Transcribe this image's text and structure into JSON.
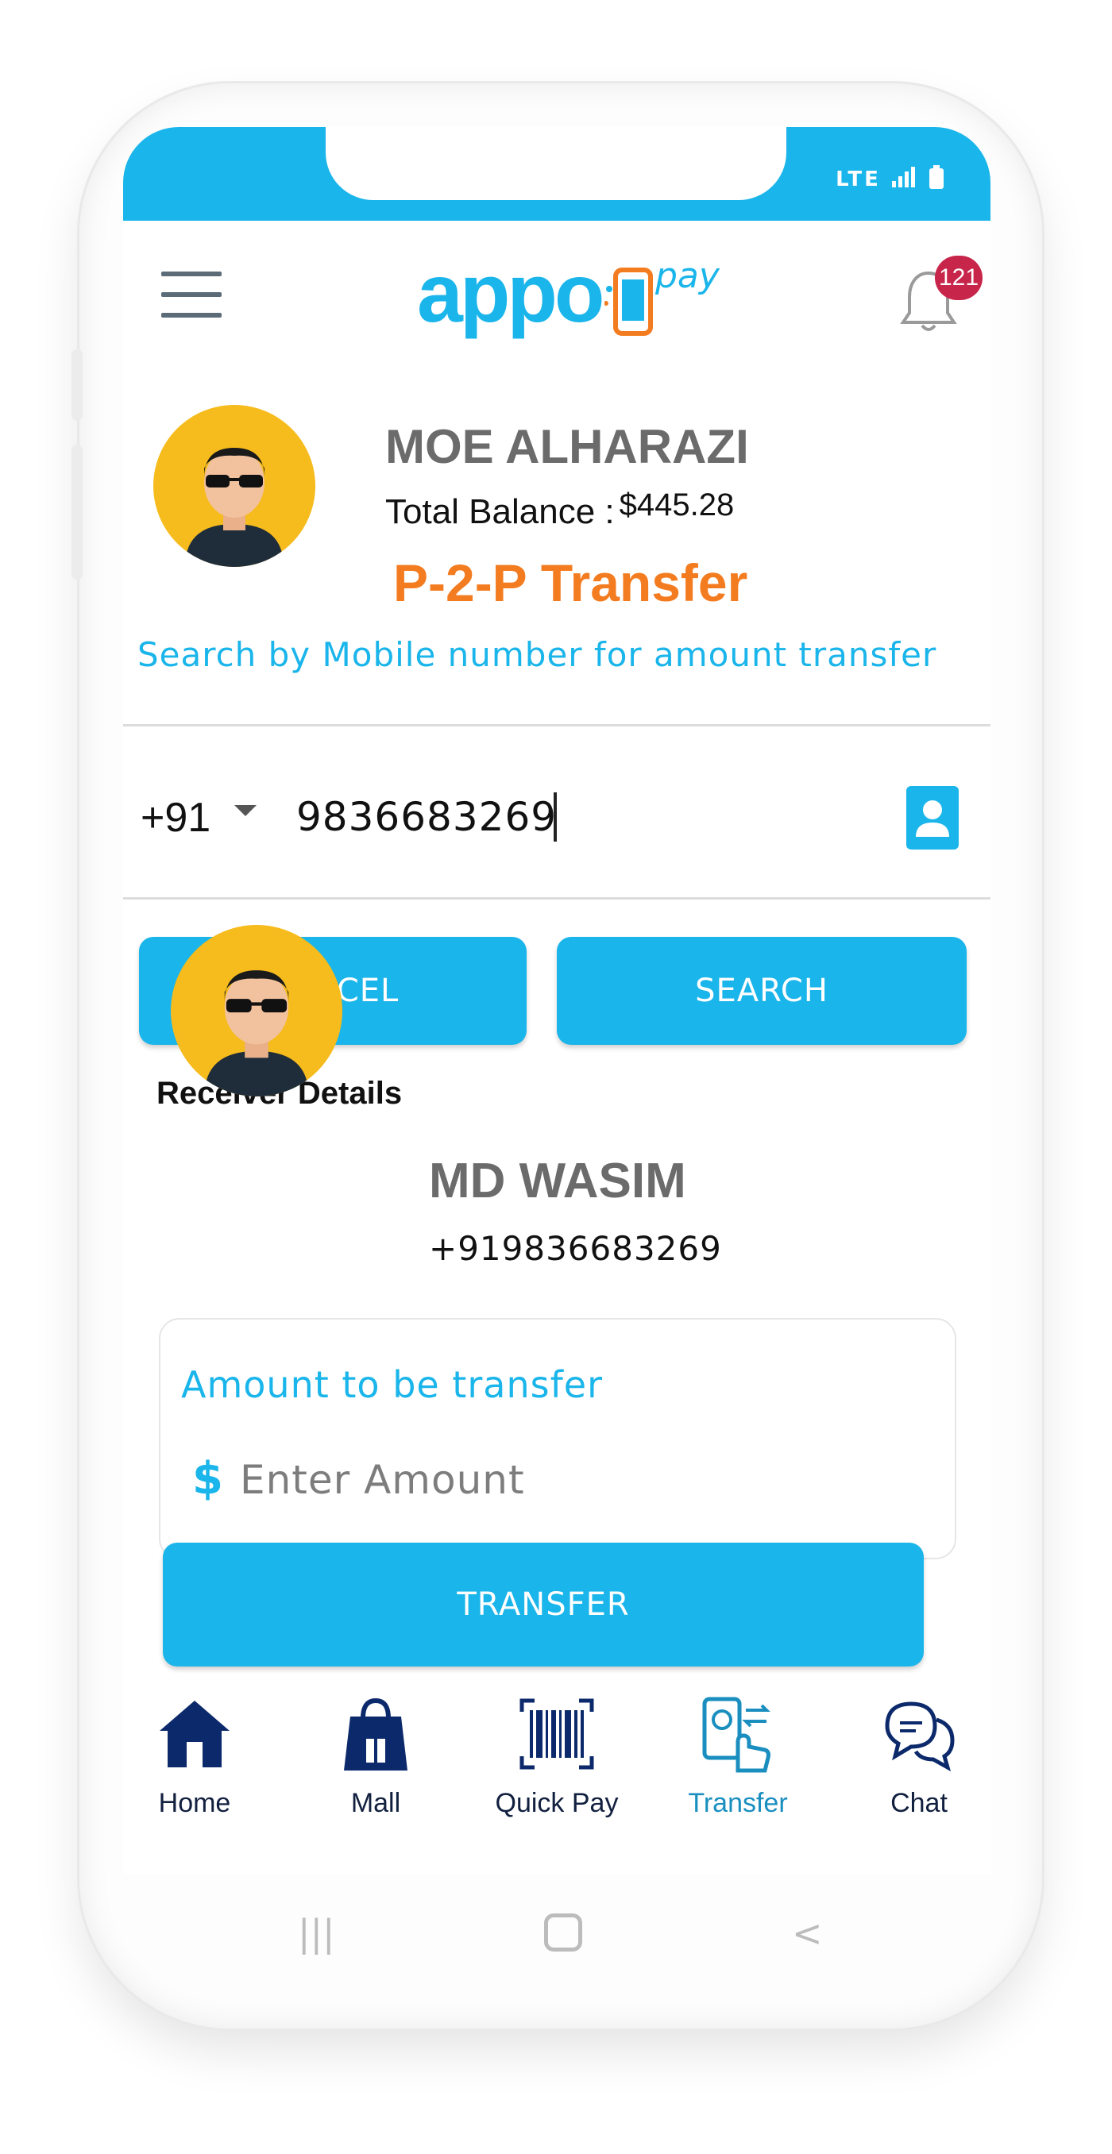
{
  "status_bar": {
    "network": "LTE"
  },
  "header": {
    "logo_main": "appo",
    "logo_sub": "pay",
    "notification_count": "121"
  },
  "profile": {
    "name": "MOE ALHARAZI",
    "balance_label": "Total Balance :",
    "balance_amount": "$445.28",
    "page_title": "P-2-P Transfer",
    "search_hint": "Search by Mobile number for amount transfer"
  },
  "phone_search": {
    "country_code": "+91",
    "phone_value": "9836683269"
  },
  "buttons": {
    "cancel": "CANCEL",
    "search": "SEARCH",
    "transfer": "TRANSFER"
  },
  "receiver": {
    "section_title": "Receiver Details",
    "name": "MD WASIM",
    "phone": "+919836683269"
  },
  "amount": {
    "label": "Amount to be transfer",
    "currency_symbol": "$",
    "placeholder": "Enter Amount"
  },
  "bottom_nav": {
    "items": [
      {
        "label": "Home",
        "icon": "home-icon"
      },
      {
        "label": "Mall",
        "icon": "shopping-bag-icon"
      },
      {
        "label": "Quick Pay",
        "icon": "barcode-icon"
      },
      {
        "label": "Transfer",
        "icon": "transfer-icon",
        "active": true
      },
      {
        "label": "Chat",
        "icon": "chat-icon"
      }
    ]
  },
  "colors": {
    "primary": "#1ab5ea",
    "accent_orange": "#f47c20",
    "nav_dark": "#12203f",
    "badge": "#c7254a",
    "avatar_bg": "#f6bb1c"
  }
}
